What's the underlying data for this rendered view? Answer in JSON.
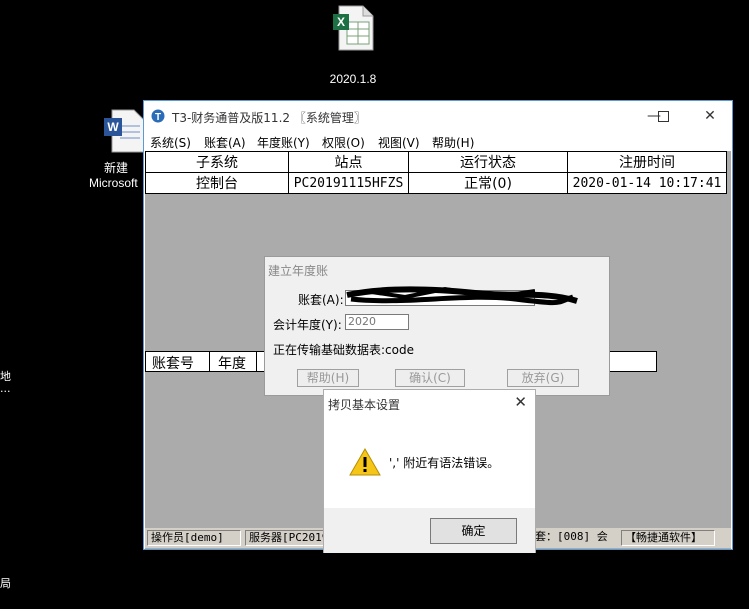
{
  "desktop": {
    "xlsx_label": "2020.1.8",
    "doc_label_line1": "新建",
    "doc_label_line2": "Microsoft",
    "left_fragments": [
      "地",
      "...",
      "局"
    ]
  },
  "window": {
    "title": "T3-财务通普及版11.2 〖系统管理〗",
    "menu": [
      "系统(S)",
      "账套(A)",
      "年度账(Y)",
      "权限(O)",
      "视图(V)",
      "帮助(H)"
    ],
    "table": {
      "headers": [
        "子系统",
        "站点",
        "运行状态",
        "注册时间"
      ],
      "rows": [
        [
          "控制台",
          "PC20191115HFZS",
          "正常(0)",
          "2020-01-14 10:17:41"
        ]
      ]
    },
    "table2_headers": [
      "账套号",
      "年度"
    ],
    "status": {
      "operator": "操作员[demo]",
      "server": "服务器[PC2019",
      "account": "套：[008] 会",
      "brand": "【畅捷通软件】"
    }
  },
  "dialog_year": {
    "title": "建立年度账",
    "account_label": "账套(A):",
    "year_label": "会计年度(Y):",
    "year_value": "2020",
    "progress_text": "正在传输基础数据表:code",
    "btn_help": "帮助(H)",
    "btn_ok": "确认(C)",
    "btn_cancel": "放弃(G)"
  },
  "dialog_copy": {
    "title": "拷贝基本设置",
    "message": "',' 附近有语法错误。",
    "ok_label": "确定"
  }
}
